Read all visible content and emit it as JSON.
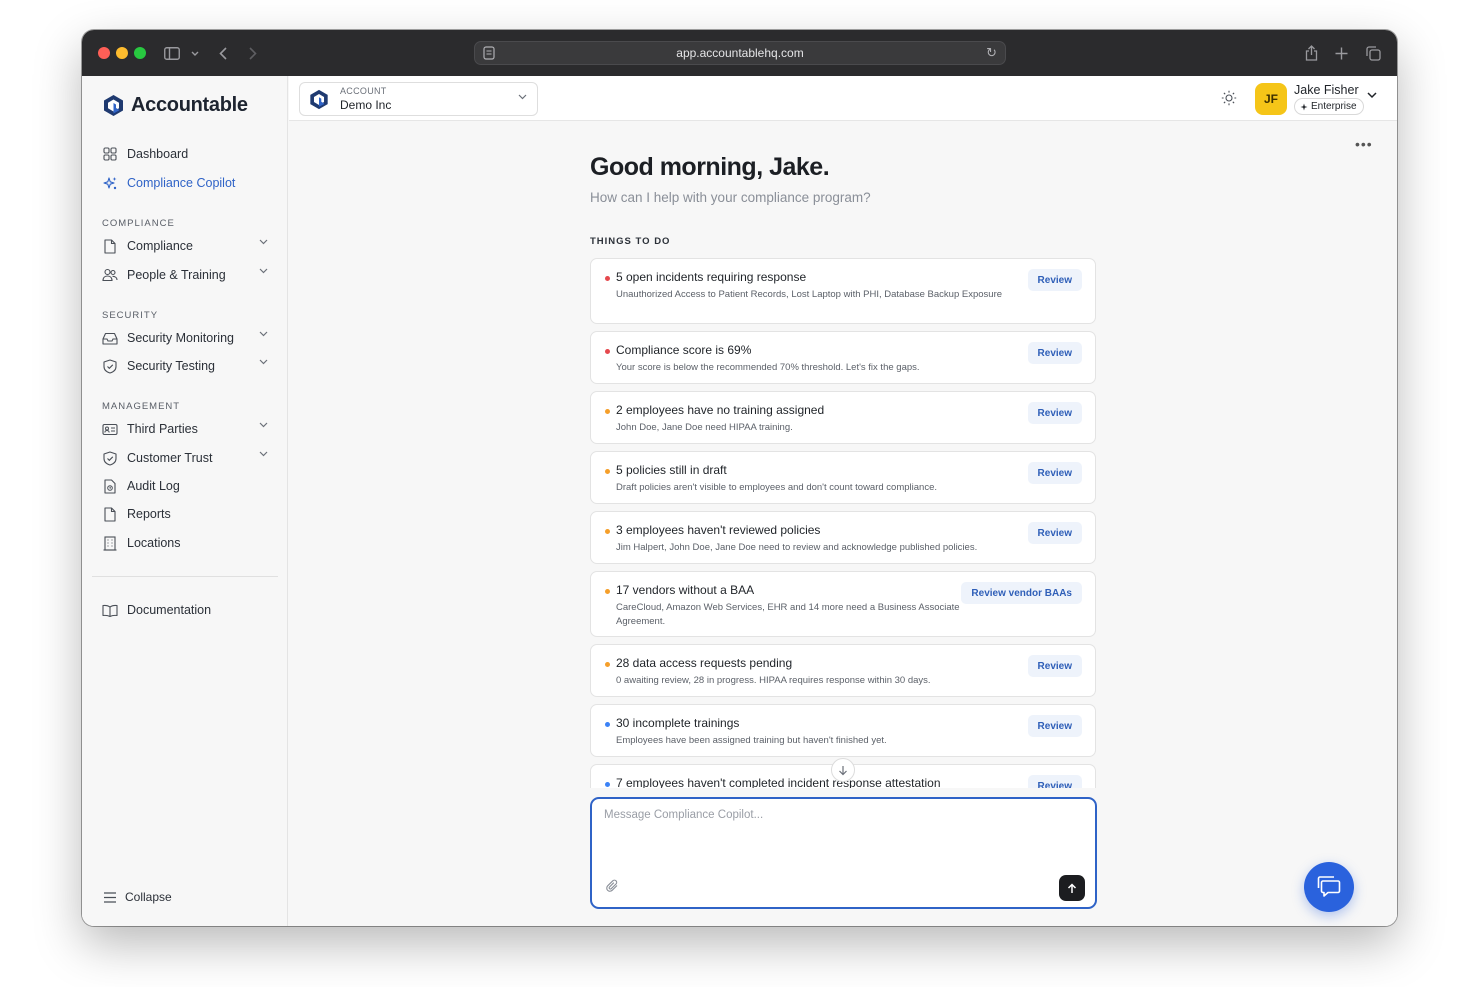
{
  "browser": {
    "url": "app.accountablehq.com"
  },
  "brand": {
    "name": "Accountable",
    "accent": "#2f63c7"
  },
  "sidebar": {
    "top_items": [
      {
        "label": "Dashboard",
        "icon": "grid-icon"
      },
      {
        "label": "Compliance Copilot",
        "icon": "sparkle-icon",
        "active": true
      }
    ],
    "sections": [
      {
        "label": "COMPLIANCE",
        "items": [
          {
            "label": "Compliance",
            "icon": "document-icon",
            "expandable": true
          },
          {
            "label": "People & Training",
            "icon": "people-icon",
            "expandable": true
          }
        ]
      },
      {
        "label": "SECURITY",
        "items": [
          {
            "label": "Security Monitoring",
            "icon": "inbox-icon",
            "expandable": true
          },
          {
            "label": "Security Testing",
            "icon": "shield-icon",
            "expandable": true
          }
        ]
      },
      {
        "label": "MANAGEMENT",
        "items": [
          {
            "label": "Third Parties",
            "icon": "id-card-icon",
            "expandable": true
          },
          {
            "label": "Customer Trust",
            "icon": "shield-check-icon",
            "expandable": true
          },
          {
            "label": "Audit Log",
            "icon": "log-icon",
            "expandable": false
          },
          {
            "label": "Reports",
            "icon": "report-icon",
            "expandable": false
          },
          {
            "label": "Locations",
            "icon": "building-icon",
            "expandable": false
          }
        ]
      }
    ],
    "documentation": "Documentation",
    "collapse": "Collapse"
  },
  "topbar": {
    "account_label": "ACCOUNT",
    "account_name": "Demo Inc",
    "user_initials": "JF",
    "user_name": "Jake Fisher",
    "plan": "Enterprise"
  },
  "main": {
    "greeting": "Good morning, Jake.",
    "subgreeting": "How can I help with your compliance program?",
    "todo_label": "THINGS TO DO",
    "todos": [
      {
        "title": "5 open incidents requiring response",
        "desc": "Unauthorized Access to Patient Records, Lost Laptop with PHI, Database Backup Exposure",
        "action": "Review",
        "severity": "#e5484d"
      },
      {
        "title": "Compliance score is 69%",
        "desc": "Your score is below the recommended 70% threshold. Let's fix the gaps.",
        "action": "Review",
        "severity": "#e5484d"
      },
      {
        "title": "2 employees have no training assigned",
        "desc": "John Doe, Jane Doe need HIPAA training.",
        "action": "Review",
        "severity": "#f59f2a"
      },
      {
        "title": "5 policies still in draft",
        "desc": "Draft policies aren't visible to employees and don't count toward compliance.",
        "action": "Review",
        "severity": "#f59f2a"
      },
      {
        "title": "3 employees haven't reviewed policies",
        "desc": "Jim Halpert, John Doe, Jane Doe need to review and acknowledge published policies.",
        "action": "Review",
        "severity": "#f59f2a"
      },
      {
        "title": "17 vendors without a BAA",
        "desc": "CareCloud, Amazon Web Services, EHR and 14 more need a Business Associate Agreement.",
        "action": "Review vendor BAAs",
        "severity": "#f59f2a"
      },
      {
        "title": "28 data access requests pending",
        "desc": "0 awaiting review, 28 in progress. HIPAA requires response within 30 days.",
        "action": "Review",
        "severity": "#f59f2a"
      },
      {
        "title": "30 incomplete trainings",
        "desc": "Employees have been assigned training but haven't finished yet.",
        "action": "Review",
        "severity": "#3b82f6"
      },
      {
        "title": "7 employees haven't completed incident response attestation",
        "desc": "",
        "action": "Review",
        "severity": "#3b82f6"
      }
    ],
    "composer_placeholder": "Message Compliance Copilot..."
  }
}
